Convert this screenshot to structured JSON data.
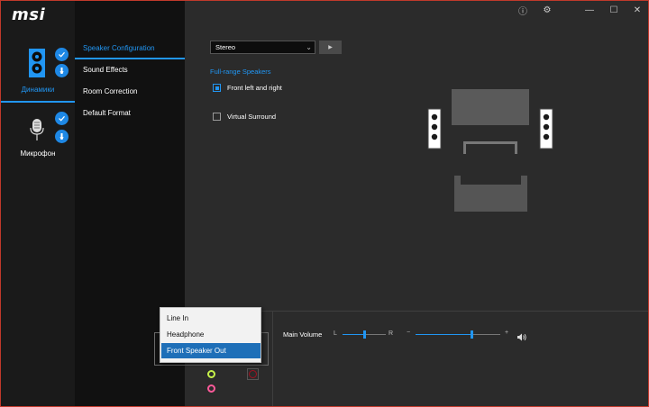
{
  "app": {
    "logo": "msi"
  },
  "window_controls": [
    {
      "name": "info-icon",
      "glyph": "ⓘ"
    },
    {
      "name": "settings-icon",
      "glyph": "⚙"
    },
    {
      "name": "minimize-button",
      "glyph": "—"
    },
    {
      "name": "maximize-button",
      "glyph": "☐"
    },
    {
      "name": "close-button",
      "glyph": "✕"
    }
  ],
  "devices": [
    {
      "label": "Динамики",
      "icon": "speaker-icon",
      "active": true
    },
    {
      "label": "Микрофон",
      "icon": "microphone-icon",
      "active": false
    }
  ],
  "nav": [
    {
      "label": "Speaker Configuration",
      "active": true
    },
    {
      "label": "Sound Effects",
      "active": false
    },
    {
      "label": "Room Correction",
      "active": false
    },
    {
      "label": "Default Format",
      "active": false
    }
  ],
  "config": {
    "mode_value": "Stereo",
    "section_title": "Full-range Speakers",
    "options": [
      {
        "label": "Front left and right",
        "checked": true
      },
      {
        "label": "Virtual Surround",
        "checked": false
      }
    ]
  },
  "volume": {
    "label": "Main Volume",
    "balance_left": "L",
    "balance_right": "R",
    "minus": "−",
    "plus": "+",
    "balance_position": 0.5,
    "level": 0.67
  },
  "jack_popup": {
    "items": [
      "Line In",
      "Headphone",
      "Front Speaker Out"
    ],
    "selected": "Front Speaker Out"
  },
  "colors": {
    "accent": "#2196f3",
    "jack_green": "#c6f24a",
    "jack_pink": "#ff5a9a",
    "jack_dark": "#a01020"
  }
}
